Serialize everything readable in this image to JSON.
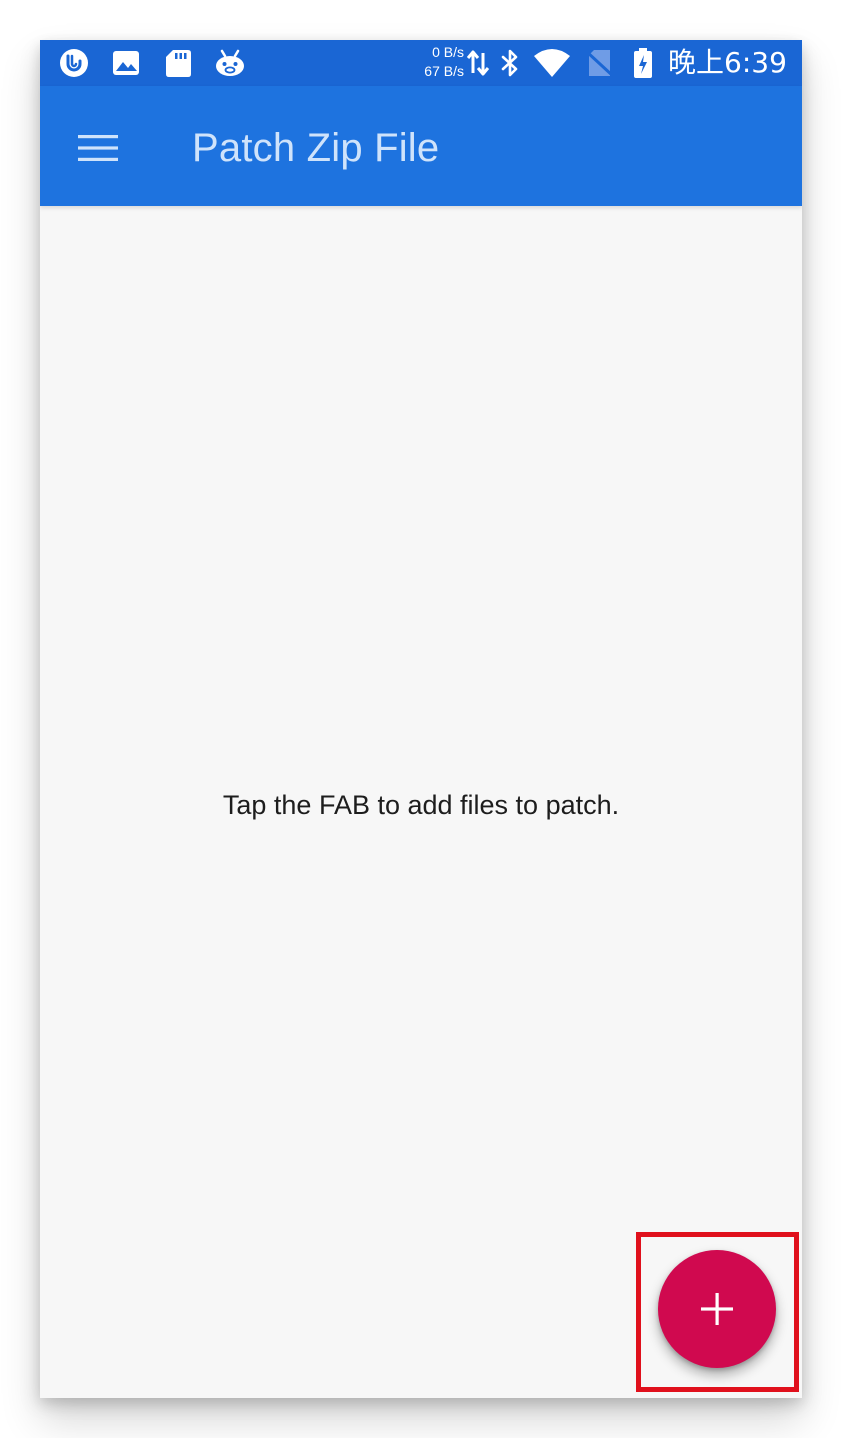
{
  "status_bar": {
    "icons_left": [
      "hook-notification-icon",
      "gallery-icon",
      "sd-card-icon",
      "robot-app-icon"
    ],
    "net_speed_up": "0 B/s",
    "net_speed_down": "67 B/s",
    "icons_right": [
      "data-arrows-icon",
      "bluetooth-icon",
      "wifi-icon",
      "no-sim-icon",
      "battery-charging-icon"
    ],
    "time": "晚上6:39"
  },
  "app_bar": {
    "title": "Patch Zip File",
    "menu_icon": "hamburger-menu-icon"
  },
  "main": {
    "empty_message": "Tap the FAB to add files to patch."
  },
  "fab": {
    "icon": "plus-icon",
    "color": "#d0094f"
  },
  "colors": {
    "status_bar": "#1a66d4",
    "app_bar": "#1e73df",
    "title_text": "#cfe3fb",
    "background": "#f7f7f7",
    "highlight": "#e0101c"
  }
}
